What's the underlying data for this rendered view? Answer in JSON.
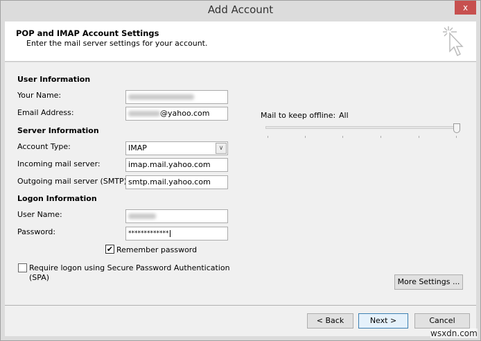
{
  "window": {
    "title": "Add Account",
    "close_label": "x"
  },
  "header": {
    "title": "POP and IMAP Account Settings",
    "subtitle": "Enter the mail server settings for your account."
  },
  "user_info": {
    "heading": "User Information",
    "your_name_label": "Your Name:",
    "email_label": "Email Address:",
    "email_suffix": "@yahoo.com"
  },
  "server_info": {
    "heading": "Server Information",
    "account_type_label": "Account Type:",
    "account_type_value": "IMAP",
    "incoming_label": "Incoming mail server:",
    "incoming_value": "imap.mail.yahoo.com",
    "outgoing_label": "Outgoing mail server (SMTP):",
    "outgoing_value": "smtp.mail.yahoo.com"
  },
  "logon_info": {
    "heading": "Logon Information",
    "user_name_label": "User Name:",
    "password_label": "Password:",
    "password_value": "*************",
    "remember_label": "Remember password",
    "remember_checked": true,
    "spa_label": "Require logon using Secure Password Authentication",
    "spa_label2": "(SPA)",
    "spa_checked": false
  },
  "offline": {
    "label": "Mail to keep offline:",
    "value": "All",
    "slider_position": "max"
  },
  "buttons": {
    "more_settings": "More Settings ...",
    "back": "< Back",
    "next": "Next >",
    "cancel": "Cancel"
  },
  "watermark": "wsxdn.com"
}
